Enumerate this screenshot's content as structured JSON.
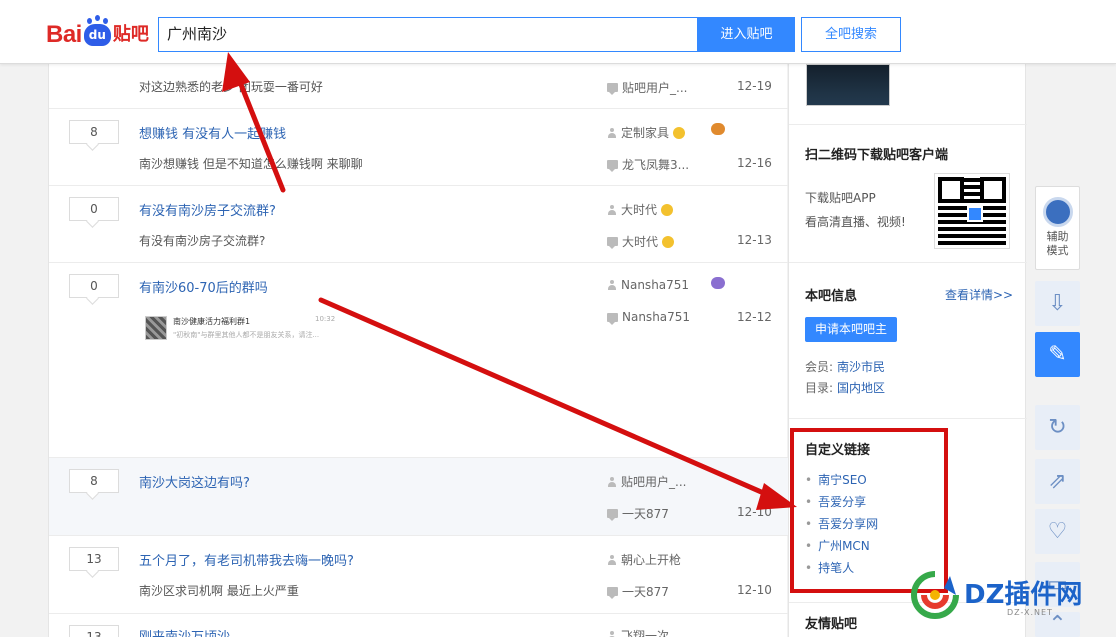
{
  "header": {
    "logo": {
      "bai": "Bai",
      "du": "du",
      "tieba": "贴吧"
    },
    "search_value": "广州南沙",
    "enter_button": "进入贴吧",
    "all_search_button": "全吧搜索"
  },
  "threads": [
    {
      "reply": "",
      "title": "",
      "abstract": "对这边熟悉的老乡 团玩耍一番可好",
      "author": "",
      "last_reply": "贴吧用户_...",
      "date": "12-19",
      "highlighted": false
    },
    {
      "reply": "8",
      "title": "想赚钱 有没有人一起赚钱",
      "abstract": "南沙想赚钱 但是不知道怎么赚钱啊 来聊聊",
      "author": "定制家具",
      "last_reply": "龙飞凤舞3...",
      "date": "12-16",
      "highlighted": false
    },
    {
      "reply": "0",
      "title": "有没有南沙房子交流群?",
      "abstract": "有没有南沙房子交流群?",
      "author": "大时代",
      "last_reply": "大时代",
      "date": "12-13",
      "highlighted": false
    },
    {
      "reply": "0",
      "title": "有南沙60-70后的群吗",
      "abstract": "",
      "author": "Nansha751",
      "last_reply": "Nansha751",
      "date": "12-12",
      "highlighted": false,
      "thumbnail": {
        "title": "南沙健康活力福利群1",
        "subtitle": "\"初秋南\"与群里其他人都不是朋友关系，请注...",
        "time": "10:32"
      }
    },
    {
      "reply": "8",
      "title": "南沙大岗这边有吗?",
      "abstract": "",
      "author": "贴吧用户_...",
      "last_reply": "一天877",
      "date": "12-10",
      "highlighted": true
    },
    {
      "reply": "13",
      "title": "五个月了，有老司机带我去嗨一晚吗?",
      "abstract": "南沙区求司机啊 最近上火严重",
      "author": "朝心上开枪",
      "last_reply": "一天877",
      "date": "12-10",
      "highlighted": false
    },
    {
      "reply": "13",
      "title": "刚来南沙万顷沙",
      "abstract": "",
      "author": "飞翔一次",
      "last_reply": "",
      "date": "",
      "highlighted": false
    }
  ],
  "sidebar": {
    "qr_heading": "扫二维码下载贴吧客户端",
    "qr_line1": "下载贴吧APP",
    "qr_line2": "看高清直播、视频!",
    "info_heading": "本吧信息",
    "view_details": "查看详情>>",
    "apply_button": "申请本吧吧主",
    "member_label": "会员:",
    "member_value": "南沙市民",
    "category_label": "目录:",
    "category_value": "国内地区",
    "custom_heading": "自定义链接",
    "custom_links": [
      "南宁SEO",
      "吾爱分享",
      "吾爱分享网",
      "广州MCN",
      "持笔人"
    ],
    "friends_heading": "友情贴吧"
  },
  "toolbar": {
    "helper_line1": "辅助",
    "helper_line2": "模式"
  },
  "watermark": {
    "text": "DZ插件网",
    "url": "DZ-X.NET"
  },
  "colors": {
    "accent": "#3388ff",
    "link": "#2d64b3",
    "annotation": "#d40f0f",
    "logo_red": "#de2a27"
  }
}
